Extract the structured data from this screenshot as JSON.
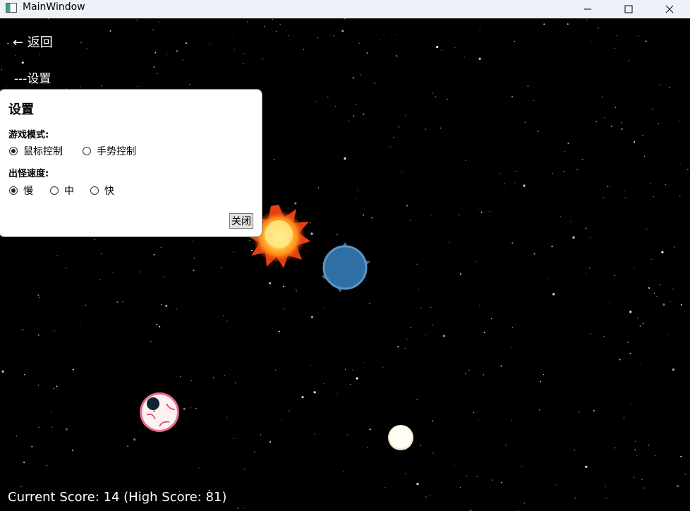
{
  "window": {
    "title": "MainWindow",
    "icons": [
      "app-icon",
      "minimize-icon",
      "maximize-icon",
      "close-icon"
    ]
  },
  "nav": {
    "back_label": "← 返回",
    "breadcrumb": "---设置"
  },
  "settings": {
    "title": "设置",
    "mode_label": "游戏模式:",
    "mode_options": [
      "鼠标控制",
      "手势控制"
    ],
    "mode_selected": "鼠标控制",
    "speed_label": "出怪速度:",
    "speed_options": [
      "慢",
      "中",
      "快"
    ],
    "speed_selected": "慢",
    "close_label": "关闭"
  },
  "hud": {
    "score_text": "Current Score: 14 (High Score: 81)"
  },
  "colors": {
    "background": "#000000",
    "titlebar": "#eef2f8",
    "player": "#2f6fa3",
    "explosion": "#ff8a1a"
  },
  "sprites": [
    "explosion",
    "player-ship",
    "eyeball-enemy",
    "egg-enemy"
  ]
}
